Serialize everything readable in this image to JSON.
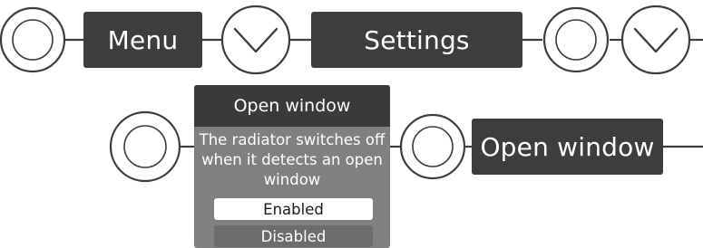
{
  "flow": {
    "menu_label": "Menu",
    "settings_label": "Settings",
    "open_window_label": "Open window"
  },
  "screen": {
    "header": "Open window",
    "description": "The radiator switches off when it detects an open window",
    "options": [
      {
        "label": "Enabled",
        "selected": true
      },
      {
        "label": "Disabled",
        "selected": false
      }
    ]
  },
  "icons": {
    "button": "circle-button-icon",
    "down": "chevron-down-icon"
  },
  "colors": {
    "box": "#3d3d3d",
    "screen_bg": "#808080",
    "screen_header": "#3a3a3a",
    "selected_option": "#ffffff",
    "line": "#3d3d3d"
  }
}
